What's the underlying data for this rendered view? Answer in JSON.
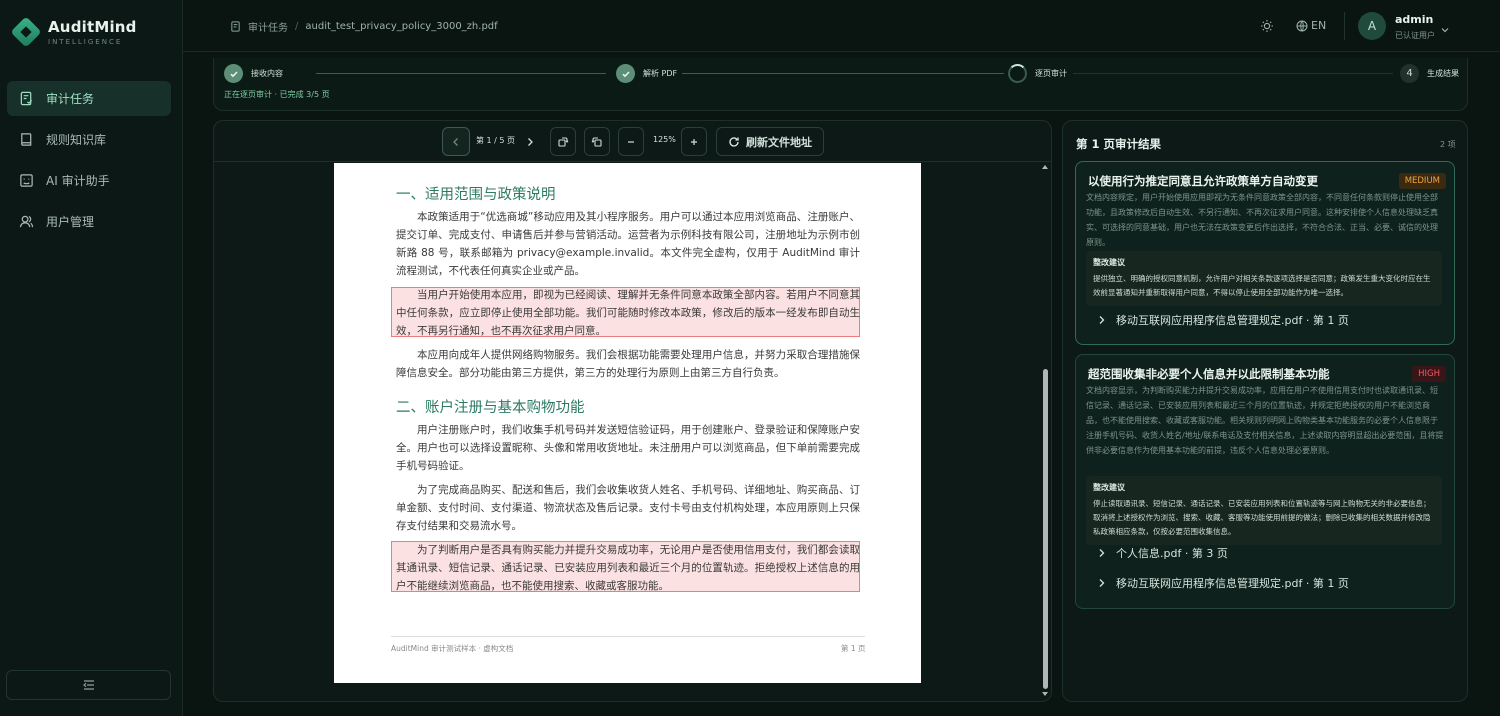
{
  "app": {
    "name": "AuditMind",
    "tagline": "INTELLIGENCE"
  },
  "sidebar": {
    "items": [
      {
        "label": "审计任务",
        "icon": "task-icon",
        "active": true
      },
      {
        "label": "规则知识库",
        "icon": "book-icon",
        "active": false
      },
      {
        "label": "AI 审计助手",
        "icon": "assistant-icon",
        "active": false
      },
      {
        "label": "用户管理",
        "icon": "users-icon",
        "active": false
      }
    ],
    "collapse_icon": "menu-collapse-icon"
  },
  "header": {
    "breadcrumb_root": "审计任务",
    "breadcrumb_sep": "/",
    "breadcrumb_current": "audit_test_privacy_policy_3000_zh.pdf",
    "lang": "EN",
    "avatar_initial": "A",
    "user_name": "admin",
    "user_role": "已认证用户"
  },
  "progress": {
    "steps": [
      {
        "label": "接收内容",
        "state": "done"
      },
      {
        "label": "解析 PDF",
        "state": "done"
      },
      {
        "label": "逐页审计",
        "state": "active"
      },
      {
        "label": "生成结果",
        "state": "todo",
        "number": "4"
      }
    ],
    "status": "正在逐页审计 · 已完成 3/5 页"
  },
  "viewer": {
    "page_indicator": "第 1 / 5 页",
    "zoom": "125%",
    "refresh_label": "刷新文件地址",
    "doc": {
      "heading1": "一、适用范围与政策说明",
      "p1": "本政策适用于“优选商城”移动应用及其小程序服务。用户可以通过本应用浏览商品、注册账户、提交订单、完成支付、申请售后并参与营销活动。运营者为示例科技有限公司，注册地址为示例市创新路 88 号，联系邮箱为 privacy@example.invalid。本文件完全虚构，仅用于 AuditMind 审计流程测试，不代表任何真实企业或产品。",
      "p2": "当用户开始使用本应用，即视为已经阅读、理解并无条件同意本政策全部内容。若用户不同意其中任何条款，应立即停止使用全部功能。我们可能随时修改本政策，修改后的版本一经发布即自动生效，不再另行通知，也不再次征求用户同意。",
      "p3": "本应用向成年人提供网络购物服务。我们会根据功能需要处理用户信息，并努力采取合理措施保障信息安全。部分功能由第三方提供，第三方的处理行为原则上由第三方自行负责。",
      "heading2": "二、账户注册与基本购物功能",
      "p4": "用户注册账户时，我们收集手机号码并发送短信验证码，用于创建账户、登录验证和保障账户安全。用户也可以选择设置昵称、头像和常用收货地址。未注册用户可以浏览商品，但下单前需要完成手机号码验证。",
      "p5": "为了完成商品购买、配送和售后，我们会收集收货人姓名、手机号码、详细地址、购买商品、订单金额、支付时间、支付渠道、物流状态及售后记录。支付卡号由支付机构处理，本应用原则上只保存支付结果和交易流水号。",
      "p6": "为了判断用户是否具有购买能力并提升交易成功率，无论用户是否使用信用支付，我们都会读取其通讯录、短信记录、通话记录、已安装应用列表和最近三个月的位置轨迹。拒绝授权上述信息的用户不能继续浏览商品，也不能使用搜索、收藏或客服功能。",
      "footer_left": "AuditMind 审计测试样本 · 虚构文档",
      "footer_right": "第 1 页"
    }
  },
  "results": {
    "title": "第 1 页审计结果",
    "count": "2 项",
    "issues": [
      {
        "title": "以使用行为推定同意且允许政策单方自动变更",
        "severity": "MEDIUM",
        "desc": "文档内容规定，用户开始使用应用即视为无条件同意政策全部内容，不同意任何条款则停止使用全部功能，且政策修改后自动生效、不另行通知、不再次征求用户同意。这种安排使个人信息处理缺乏真实、可选择的同意基础，用户也无法在政策变更后作出选择，不符合合法、正当、必要、诚信的处理原则。",
        "advice_title": "整改建议",
        "advice": "提供独立、明确的授权同意机制，允许用户对相关条款逐项选择是否同意；政策发生重大变化时应在生效前显著通知并重新取得用户同意，不得以停止使用全部功能作为唯一选择。",
        "refs": [
          "移动互联网应用程序信息管理规定.pdf · 第 1 页"
        ]
      },
      {
        "title": "超范围收集非必要个人信息并以此限制基本功能",
        "severity": "HIGH",
        "desc": "文档内容显示，为判断购买能力并提升交易成功率，应用在用户不使用信用支付时也读取通讯录、短信记录、通话记录、已安装应用列表和最近三个月的位置轨迹，并规定拒绝授权的用户不能浏览商品，也不能使用搜索、收藏或客服功能。相关规则列明网上购物类基本功能服务的必要个人信息限于注册手机号码、收货人姓名/地址/联系电话及支付相关信息，上述读取内容明显超出必要范围，且将提供非必要信息作为使用基本功能的前提，违反个人信息处理必要原则。",
        "advice_title": "整改建议",
        "advice": "停止读取通讯录、短信记录、通话记录、已安装应用列表和位置轨迹等与网上购物无关的非必要信息；取消将上述授权作为浏览、搜索、收藏、客服等功能使用前提的做法；删除已收集的相关数据并修改隐私政策相应条款，仅按必要范围收集信息。",
        "refs": [
          "个人信息.pdf · 第 3 页",
          "移动互联网应用程序信息管理规定.pdf · 第 1 页"
        ]
      }
    ]
  },
  "colors": {
    "accent": "#2c7a63",
    "highlight_bg": "#fbe1e1",
    "highlight_border": "#ef7c7c",
    "medium": "#f1a23d",
    "high": "#ec5b63"
  }
}
